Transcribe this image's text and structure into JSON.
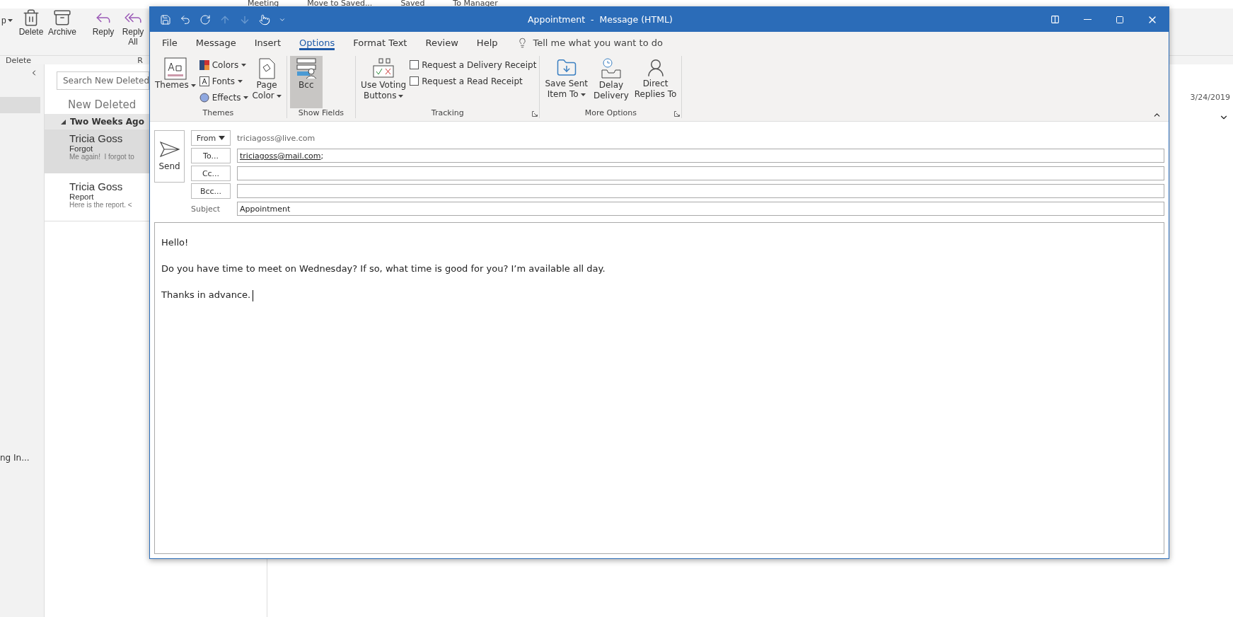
{
  "background": {
    "quick_steps": [
      "Meeting",
      "Move to Saved...",
      "Saved",
      "To Manager"
    ],
    "ribbon_buttons": [
      {
        "label": "p",
        "kind": "dropdown"
      },
      {
        "label": "Delete",
        "kind": "delete"
      },
      {
        "label": "Archive",
        "kind": "archive"
      },
      {
        "label": "Reply",
        "kind": "reply"
      },
      {
        "label": "Reply All",
        "kind": "reply-all"
      }
    ],
    "group_labels": [
      "Delete",
      "R"
    ],
    "folder_item": "ng In...",
    "search": {
      "placeholder": "Search New Deleted"
    },
    "folder_title": "New Deleted",
    "group_header": "Two Weeks Ago",
    "messages": [
      {
        "sender": "Tricia Goss",
        "subject": "Forgot",
        "preview": "Me again!  I forgot to",
        "selected": true
      },
      {
        "sender": "Tricia Goss",
        "subject": "Report",
        "preview": "Here is the report. <",
        "selected": false
      }
    ],
    "date": "3/24/2019"
  },
  "window": {
    "title": "Appointment  -  Message (HTML)",
    "tabs": [
      {
        "label": "File",
        "selected": false
      },
      {
        "label": "Message",
        "selected": false
      },
      {
        "label": "Insert",
        "selected": false
      },
      {
        "label": "Options",
        "selected": true
      },
      {
        "label": "Format Text",
        "selected": false
      },
      {
        "label": "Review",
        "selected": false
      },
      {
        "label": "Help",
        "selected": false
      }
    ],
    "tell_me": {
      "placeholder": "Tell me what you want to do"
    },
    "ribbon": [
      {
        "label": "Themes",
        "launcher": false,
        "buttons": [
          {
            "kind": "themes",
            "lines": [
              "Themes"
            ],
            "dropdown": true,
            "selected": false
          },
          {
            "kind": "colors",
            "lines": [
              "Colors"
            ],
            "dropdown": true
          },
          {
            "kind": "fonts",
            "lines": [
              "Fonts"
            ],
            "dropdown": true
          },
          {
            "kind": "effects",
            "lines": [
              "Effects"
            ],
            "dropdown": true
          },
          {
            "kind": "page-color",
            "lines": [
              "Page",
              "Color"
            ],
            "dropdown": true,
            "selected": false
          }
        ]
      },
      {
        "label": "Show Fields",
        "launcher": false,
        "buttons": [
          {
            "kind": "bcc",
            "lines": [
              "Bcc"
            ],
            "dropdown": false,
            "selected": true
          }
        ]
      },
      {
        "label": "Tracking",
        "launcher": true,
        "buttons": [
          {
            "kind": "voting",
            "lines": [
              "Use Voting",
              "Buttons"
            ],
            "dropdown": true,
            "selected": false
          },
          {
            "kind": "checkbox",
            "lines": [
              "Request a Delivery Receipt"
            ],
            "checked": false
          },
          {
            "kind": "checkbox",
            "lines": [
              "Request a Read Receipt"
            ],
            "checked": false
          }
        ]
      },
      {
        "label": "More Options",
        "launcher": true,
        "buttons": [
          {
            "kind": "save-sent",
            "lines": [
              "Save Sent",
              "Item To"
            ],
            "dropdown": true,
            "selected": false
          },
          {
            "kind": "delay",
            "lines": [
              "Delay",
              "Delivery"
            ],
            "dropdown": false,
            "selected": false
          },
          {
            "kind": "direct-replies",
            "lines": [
              "Direct",
              "Replies To"
            ],
            "dropdown": false,
            "selected": false
          }
        ]
      }
    ],
    "send": "Send",
    "from": {
      "label": "From",
      "value": "triciagoss@live.com"
    },
    "recipients": [
      {
        "label": "To...",
        "value": "triciagoss@mail.com",
        "separator": ";"
      },
      {
        "label": "Cc..."
      },
      {
        "label": "Bcc..."
      }
    ],
    "subject": {
      "label": "Subject",
      "value": "Appointment"
    },
    "body": [
      "Hello!",
      "Do you have time to meet on Wednesday? If so, what time is good for you? I’m available all day.",
      "Thanks in advance."
    ]
  }
}
